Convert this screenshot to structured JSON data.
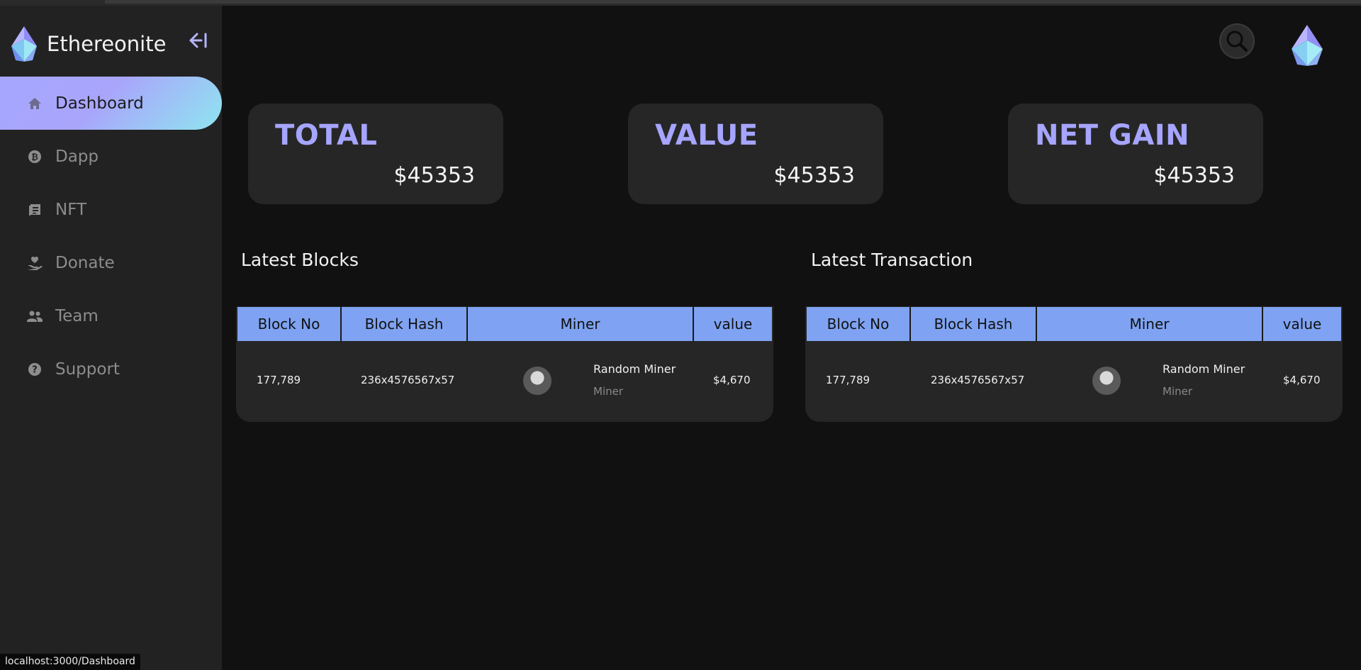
{
  "brand": {
    "name": "Ethereonite"
  },
  "sidebar": {
    "items": [
      {
        "label": "Dashboard",
        "icon": "home-icon",
        "active": true
      },
      {
        "label": "Dapp",
        "icon": "bitcoin-icon",
        "active": false
      },
      {
        "label": "NFT",
        "icon": "document-icon",
        "active": false
      },
      {
        "label": "Donate",
        "icon": "donate-hand-icon",
        "active": false
      },
      {
        "label": "Team",
        "icon": "team-icon",
        "active": false
      },
      {
        "label": "Support",
        "icon": "help-icon",
        "active": false
      }
    ]
  },
  "status_bar": {
    "url": "localhost:3000/Dashboard"
  },
  "stats": [
    {
      "title": "TOTAL",
      "value": "$45353"
    },
    {
      "title": "VALUE",
      "value": "$45353"
    },
    {
      "title": "NET GAIN",
      "value": "$45353"
    }
  ],
  "blocks": {
    "title": "Latest Blocks",
    "columns": [
      "Block No",
      "Block Hash",
      "Miner",
      "value"
    ],
    "rows": [
      {
        "block_no": "177,789",
        "block_hash": "236x4576567x57",
        "miner_name": "Random Miner",
        "miner_role": "Miner",
        "value": "$4,670"
      }
    ]
  },
  "transactions": {
    "title": "Latest Transaction",
    "columns": [
      "Block No",
      "Block Hash",
      "Miner",
      "value"
    ],
    "rows": [
      {
        "block_no": "177,789",
        "block_hash": "236x4576567x57",
        "miner_name": "Random Miner",
        "miner_role": "Miner",
        "value": "$4,670"
      }
    ]
  },
  "colors": {
    "accent": "#a6a5ff",
    "table_header": "#7fa3f2",
    "active_gradient_end": "#8fe5f0",
    "background": "#111111",
    "sidebar": "#222222"
  }
}
